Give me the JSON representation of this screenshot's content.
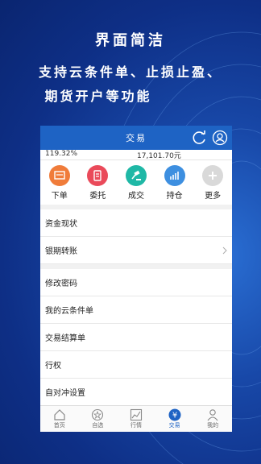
{
  "promo": {
    "title": "界面简洁",
    "line1": "支持云条件单、止损止盈、",
    "line2": "期货开户等功能"
  },
  "header": {
    "title": "交易"
  },
  "summary": {
    "left_value": "119.32%",
    "right_value": "17,101.70元"
  },
  "quick_actions": [
    {
      "label": "下单",
      "color": "#f07c3a",
      "icon": "order-icon"
    },
    {
      "label": "委托",
      "color": "#ea4a5a",
      "icon": "entrust-icon"
    },
    {
      "label": "成交",
      "color": "#1fb8a6",
      "icon": "gavel-icon"
    },
    {
      "label": "持仓",
      "color": "#3d8fe0",
      "icon": "chart-icon"
    },
    {
      "label": "更多",
      "color": "#d9d9d9",
      "icon": "plus-icon"
    }
  ],
  "menu_group1": [
    {
      "label": "资金现状"
    },
    {
      "label": "银期转账"
    }
  ],
  "menu_group2": [
    {
      "label": "修改密码"
    },
    {
      "label": "我的云条件单"
    },
    {
      "label": "交易结算单"
    },
    {
      "label": "行权"
    },
    {
      "label": "自对冲设置"
    }
  ],
  "tabs": [
    {
      "label": "首页",
      "icon": "home-icon"
    },
    {
      "label": "自选",
      "icon": "star-icon"
    },
    {
      "label": "行情",
      "icon": "market-chart-icon"
    },
    {
      "label": "交易",
      "icon": "yen-icon",
      "active": true
    },
    {
      "label": "我的",
      "icon": "person-icon"
    }
  ],
  "colors": {
    "header": "#1e63c4",
    "accent": "#1e63c4"
  }
}
